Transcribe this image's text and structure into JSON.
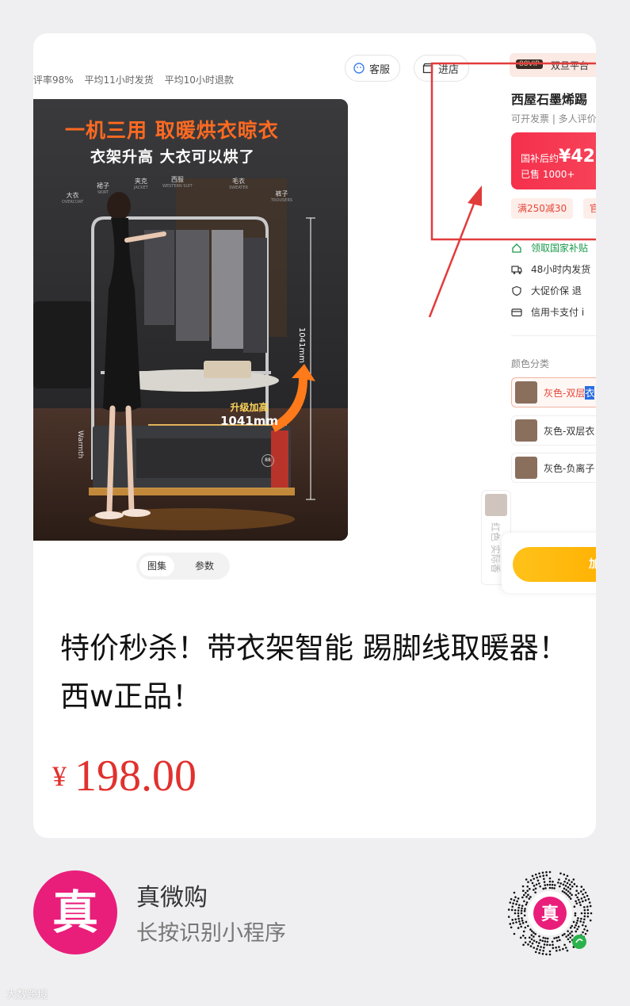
{
  "screenshot": {
    "stats": [
      "评率98%",
      "平均11小时发货",
      "平均10小时退款"
    ],
    "buttons": {
      "service": "客服",
      "shop": "进店"
    },
    "photo": {
      "headline": "一机三用 取暖烘衣晾衣",
      "subline": "衣架升高 大衣可以烘了",
      "labels": [
        {
          "cn": "大衣",
          "en": "OVERCOAT"
        },
        {
          "cn": "裙子",
          "en": "SKIRT"
        },
        {
          "cn": "夹克",
          "en": "JACKET"
        },
        {
          "cn": "西服",
          "en": "WESTERN SUIT"
        },
        {
          "cn": "毛衣",
          "en": "SWEATER"
        },
        {
          "cn": "裤子",
          "en": "TROUSERS"
        }
      ],
      "badge_line1": "升级加高",
      "badge_line2": "1041mm",
      "dimension": "1041mm",
      "brand": "Warmth",
      "display": "88"
    },
    "tabs": [
      "图集",
      "参数"
    ],
    "product": {
      "vip_tag": "88VIP",
      "vip_text": "双旦平台",
      "title": "西屋石墨烯踢",
      "meta": "可开发票 | 多人评价",
      "price_label": "国补后约",
      "price_value": "¥42",
      "sold": "已售 1000+",
      "coupons": [
        "满250减30",
        "官"
      ],
      "services": [
        "领取国家补贴",
        "48小时内发货",
        "大促价保  退",
        "信用卡支付  i"
      ],
      "color_label": "颜色分类",
      "options": [
        {
          "label_main": "灰色-双层",
          "label_hl": "衣",
          "state": "selected"
        },
        {
          "label_main": "灰色-双层衣",
          "label_hl": "",
          "state": "normal"
        },
        {
          "label_main": "灰色-负离子",
          "label_hl": "",
          "state": "normal"
        },
        {
          "label_main": "红色 实际香",
          "label_hl": "",
          "state": "disabled"
        }
      ],
      "buy_label": "加"
    },
    "accent": "#e23b3b"
  },
  "caption": "特价秒杀！带衣架智能 踢脚线取暖器！西w正品！",
  "price": {
    "currency": "¥",
    "value": "198.00"
  },
  "footer": {
    "logo_char": "真",
    "app_name": "真微购",
    "app_sub": "长按识别小程序",
    "qr_char": "真"
  },
  "watermark": "大数跨境"
}
